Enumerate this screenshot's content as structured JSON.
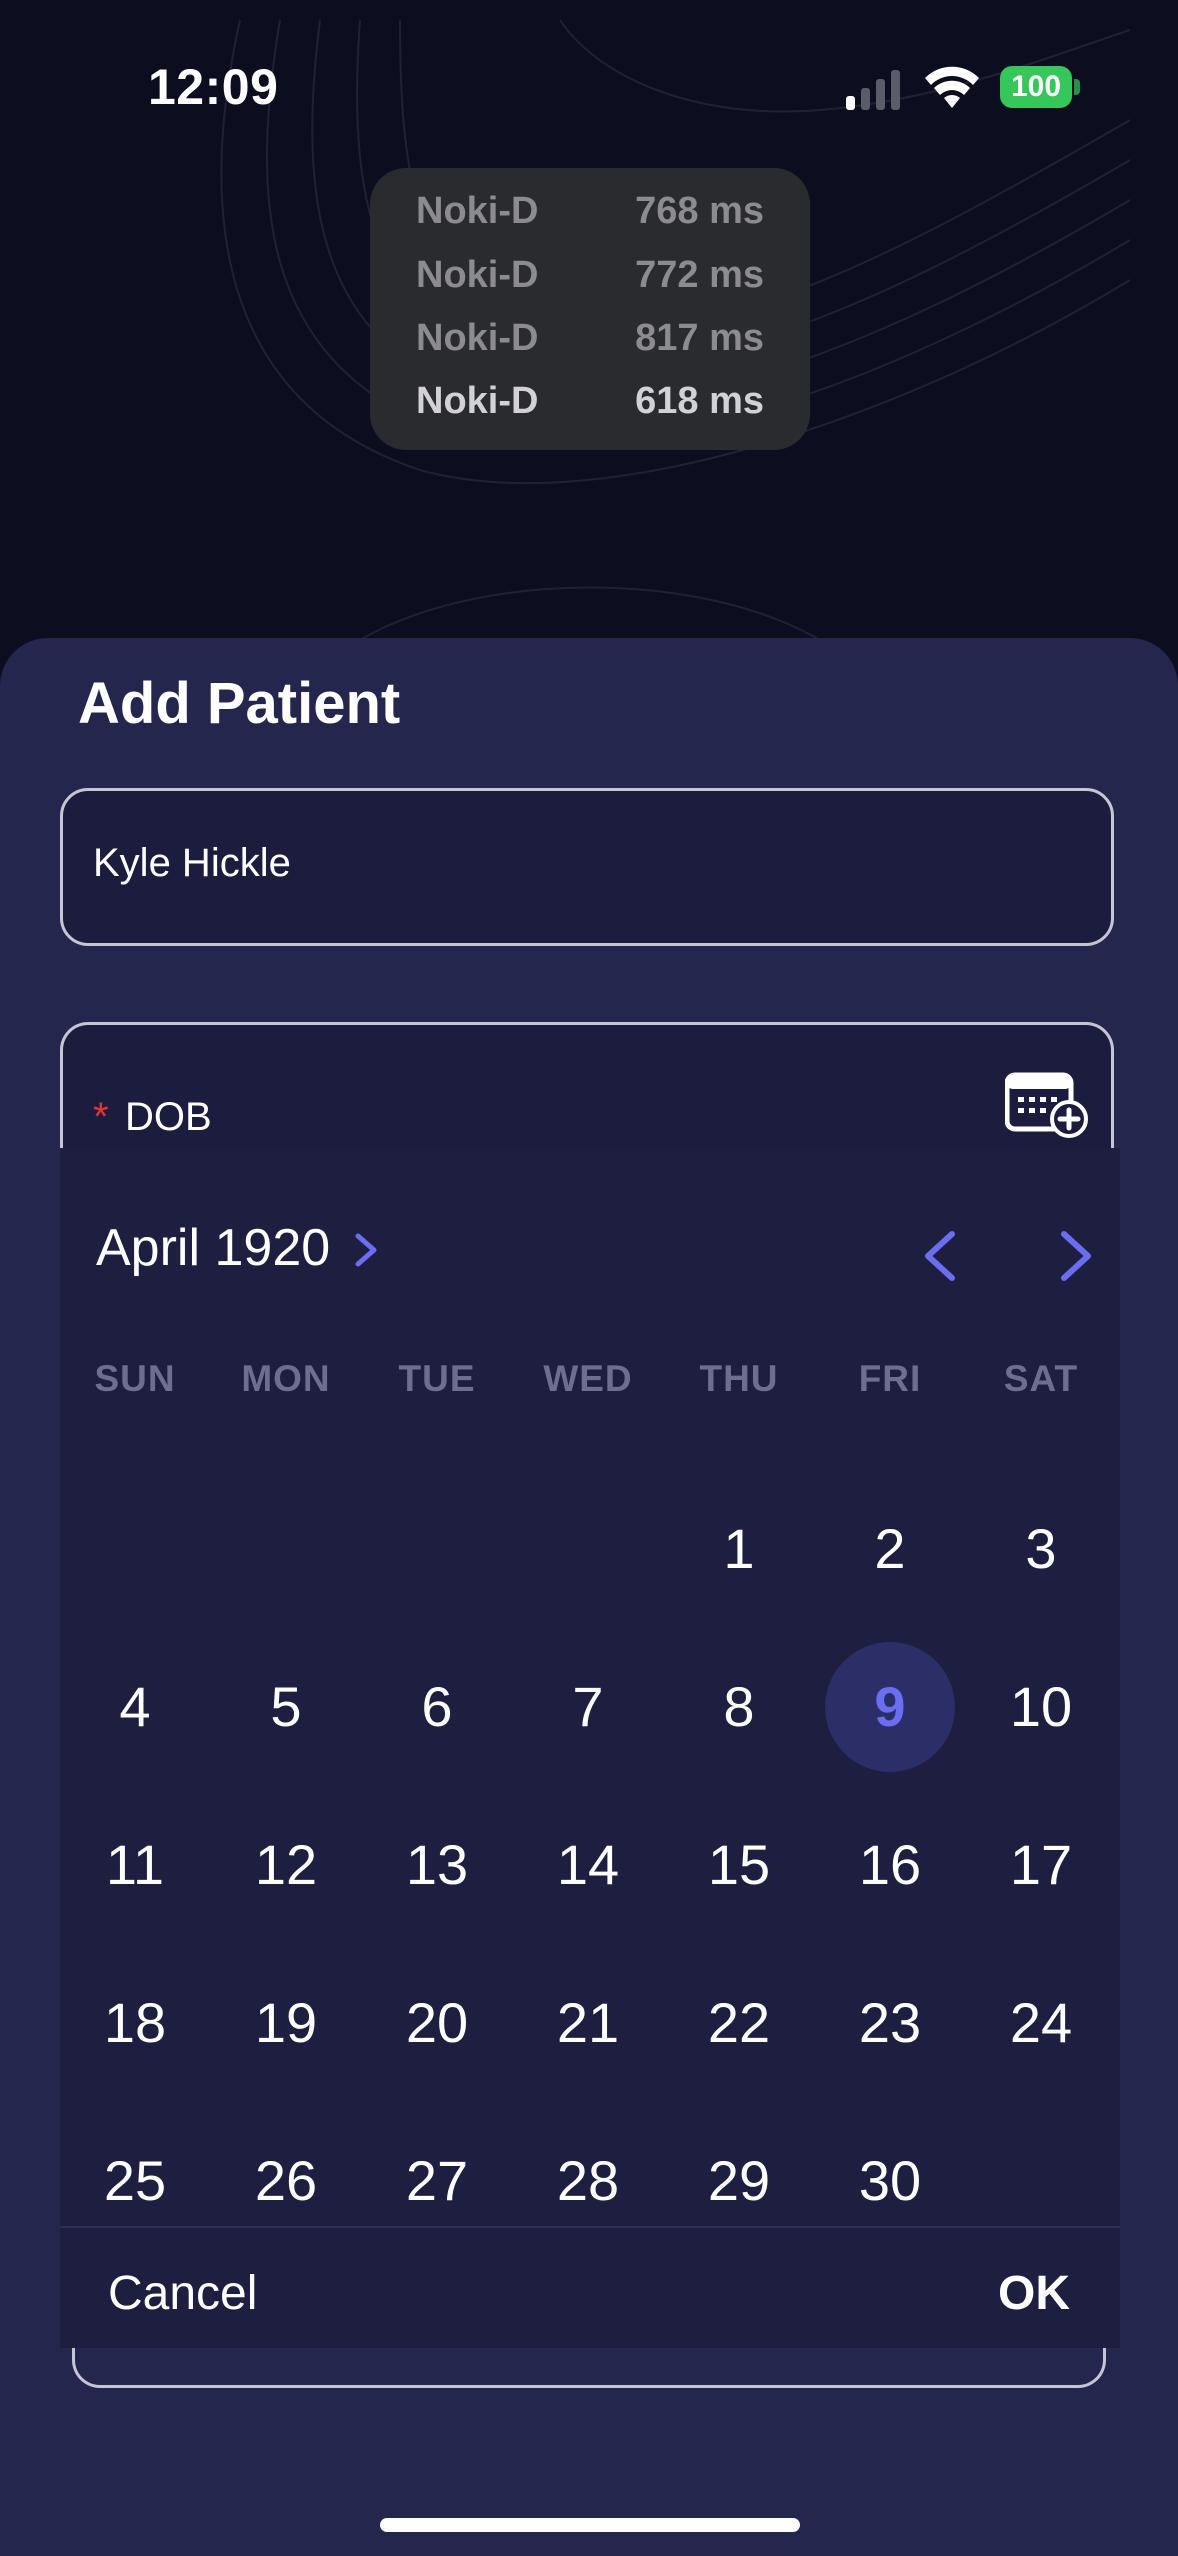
{
  "status_bar": {
    "time": "12:09",
    "battery": "100"
  },
  "latency_toast": {
    "rows": [
      {
        "device": "Noki-D",
        "latency": "768 ms"
      },
      {
        "device": "Noki-D",
        "latency": "772 ms"
      },
      {
        "device": "Noki-D",
        "latency": "817 ms"
      },
      {
        "device": "Noki-D",
        "latency": "618 ms"
      }
    ]
  },
  "sheet": {
    "title": "Add Patient",
    "name_field": {
      "value": "Kyle Hickle"
    },
    "dob_field": {
      "required_marker": "*",
      "label": "DOB",
      "icon": "calendar-add-icon"
    }
  },
  "date_picker": {
    "month_year": "April 1920",
    "weekdays": [
      "SUN",
      "MON",
      "TUE",
      "WED",
      "THU",
      "FRI",
      "SAT"
    ],
    "days": [
      "1",
      "2",
      "3",
      "4",
      "5",
      "6",
      "7",
      "8",
      "9",
      "10",
      "11",
      "12",
      "13",
      "14",
      "15",
      "16",
      "17",
      "18",
      "19",
      "20",
      "21",
      "22",
      "23",
      "24",
      "25",
      "26",
      "27",
      "28",
      "29",
      "30"
    ],
    "first_weekday_index": 4,
    "selected_day": "9",
    "cancel_label": "Cancel",
    "ok_label": "OK",
    "accent_color": "#6a6ef0"
  },
  "colors": {
    "background": "#0c0e1f",
    "sheet": "#24264d",
    "picker": "#1d1e40",
    "required": "#e8313a",
    "battery": "#35c759"
  }
}
